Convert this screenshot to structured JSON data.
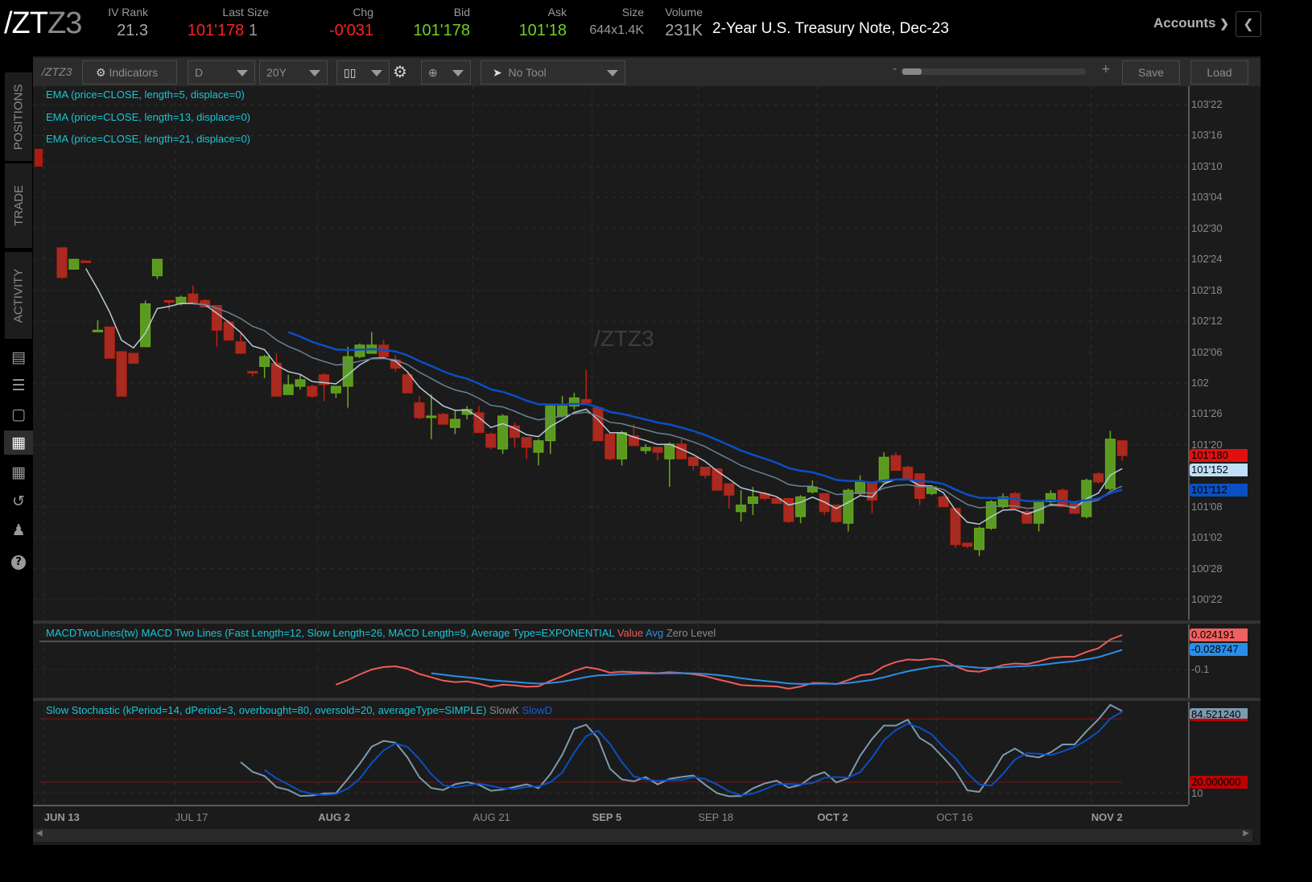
{
  "header": {
    "symbol_main": "/ZT",
    "symbol_suffix": "Z3",
    "description": "2-Year U.S. Treasury Note, Dec-23",
    "stats": {
      "iv_rank": {
        "label": "IV Rank",
        "value": "21.3"
      },
      "last_size": {
        "label": "Last Size",
        "value": "101'178",
        "size": "1"
      },
      "chg": {
        "label": "Chg",
        "value": "-0'031"
      },
      "bid": {
        "label": "Bid",
        "value": "101'178"
      },
      "ask": {
        "label": "Ask",
        "value": "101'18"
      },
      "size": {
        "label": "Size",
        "value": "644x1.4K"
      },
      "volume": {
        "label": "Volume",
        "value": "231K"
      }
    },
    "accounts_label": "Accounts",
    "colors": {
      "down": "#ff2020",
      "up": "#6fd21a"
    }
  },
  "sidebar": {
    "tabs": [
      "POSITIONS",
      "TRADE",
      "ACTIVITY"
    ],
    "icons": [
      "news-icon",
      "watchlist-icon",
      "tv-icon",
      "chart-icon",
      "grid-icon",
      "history-icon",
      "community-icon",
      "help-icon"
    ],
    "active_icon": "chart-icon"
  },
  "toolbar": {
    "symbol": "/ZTZ3",
    "indicators_label": "Indicators",
    "aggregation": "D",
    "timeframe": "20Y",
    "drawing_tool": "No Tool",
    "zoom_minus": "-",
    "zoom_plus": "+",
    "save_label": "Save",
    "load_label": "Load"
  },
  "chart_data": [
    {
      "type": "candlestick",
      "watermark": "/ZTZ3",
      "studies": [
        "EMA (price=CLOSE, length=5, displace=0)",
        "EMA (price=CLOSE, length=13, displace=0)",
        "EMA (price=CLOSE, length=21, displace=0)"
      ],
      "ema_lengths": [
        5,
        13,
        21
      ],
      "ema_colors": [
        "#b8cad8",
        "#6a8292",
        "#0a4fc4"
      ],
      "up_color": "#5a9a20",
      "down_color": "#a82a20",
      "ylim": [
        100.55,
        103.8
      ],
      "price_ticks": [
        {
          "label": "103'22",
          "value": 103.6875
        },
        {
          "label": "103'16",
          "value": 103.5
        },
        {
          "label": "103'10",
          "value": 103.3125
        },
        {
          "label": "103'04",
          "value": 103.125
        },
        {
          "label": "102'30",
          "value": 102.9375
        },
        {
          "label": "102'24",
          "value": 102.75
        },
        {
          "label": "102'18",
          "value": 102.5625
        },
        {
          "label": "102'12",
          "value": 102.375
        },
        {
          "label": "102'06",
          "value": 102.1875
        },
        {
          "label": "102",
          "value": 102.0
        },
        {
          "label": "101'26",
          "value": 101.8125
        },
        {
          "label": "101'20",
          "value": 101.625
        },
        {
          "label": "101'08",
          "value": 101.25
        },
        {
          "label": "101'02",
          "value": 101.0625
        },
        {
          "label": "100'28",
          "value": 100.875
        },
        {
          "label": "100'22",
          "value": 100.6875
        }
      ],
      "price_tags": [
        {
          "label": "101'180",
          "value": 101.5625,
          "color": "#e01010"
        },
        {
          "label": "101'152",
          "value": 101.475,
          "color": "#bfe0f8"
        },
        {
          "label": "101'112",
          "value": 101.35,
          "color": "#0a4fc4"
        }
      ],
      "x_ticks": [
        {
          "label": "JUN 13",
          "bold": true
        },
        {
          "label": "JUL 17",
          "bold": false
        },
        {
          "label": "AUG 2",
          "bold": true
        },
        {
          "label": "AUG 21",
          "bold": false
        },
        {
          "label": "SEP 5",
          "bold": true
        },
        {
          "label": "SEP 18",
          "bold": false
        },
        {
          "label": "OCT 2",
          "bold": true
        },
        {
          "label": "OCT 16",
          "bold": false
        },
        {
          "label": "NOV 2",
          "bold": true
        }
      ],
      "ohlc": [
        [
          102.82,
          102.82,
          102.63,
          102.64
        ],
        [
          102.69,
          102.75,
          102.69,
          102.75
        ],
        [
          102.74,
          102.74,
          102.73,
          102.73
        ],
        [
          102.32,
          102.38,
          102.32,
          102.32
        ],
        [
          102.34,
          102.34,
          102.15,
          102.15
        ],
        [
          102.19,
          102.19,
          101.92,
          101.92
        ],
        [
          102.18,
          102.18,
          102.12,
          102.12
        ],
        [
          102.22,
          102.5,
          102.22,
          102.48
        ],
        [
          102.65,
          102.75,
          102.63,
          102.75
        ],
        [
          102.5,
          102.5,
          102.44,
          102.49
        ],
        [
          102.48,
          102.53,
          102.47,
          102.52
        ],
        [
          102.54,
          102.59,
          102.48,
          102.48
        ],
        [
          102.5,
          102.51,
          102.46,
          102.46
        ],
        [
          102.47,
          102.47,
          102.22,
          102.32
        ],
        [
          102.37,
          102.38,
          102.26,
          102.26
        ],
        [
          102.25,
          102.3,
          102.18,
          102.18
        ],
        [
          102.07,
          102.07,
          102.04,
          102.06
        ],
        [
          102.1,
          102.17,
          102.03,
          102.16
        ],
        [
          102.12,
          102.18,
          101.92,
          101.92
        ],
        [
          101.93,
          102.05,
          101.93,
          101.99
        ],
        [
          101.98,
          102.05,
          101.96,
          102.02
        ],
        [
          101.98,
          101.99,
          101.91,
          101.92
        ],
        [
          102.05,
          102.06,
          101.89,
          101.99
        ],
        [
          101.94,
          101.98,
          101.91,
          101.98
        ],
        [
          101.98,
          102.22,
          101.85,
          102.16
        ],
        [
          102.16,
          102.24,
          102.15,
          102.23
        ],
        [
          102.18,
          102.31,
          102.18,
          102.23
        ],
        [
          102.23,
          102.26,
          102.15,
          102.16
        ],
        [
          102.14,
          102.17,
          102.07,
          102.09
        ],
        [
          102.05,
          102.06,
          101.94,
          101.94
        ],
        [
          101.88,
          101.92,
          101.78,
          101.79
        ],
        [
          101.79,
          101.93,
          101.66,
          101.8
        ],
        [
          101.81,
          101.82,
          101.75,
          101.75
        ],
        [
          101.73,
          101.84,
          101.69,
          101.78
        ],
        [
          101.81,
          101.86,
          101.78,
          101.84
        ],
        [
          101.82,
          101.86,
          101.7,
          101.7
        ],
        [
          101.69,
          101.7,
          101.6,
          101.61
        ],
        [
          101.6,
          101.81,
          101.57,
          101.8
        ],
        [
          101.74,
          101.76,
          101.61,
          101.67
        ],
        [
          101.67,
          101.67,
          101.54,
          101.61
        ],
        [
          101.58,
          101.66,
          101.5,
          101.65
        ],
        [
          101.65,
          101.87,
          101.57,
          101.86
        ],
        [
          101.8,
          101.92,
          101.79,
          101.86
        ],
        [
          101.86,
          101.94,
          101.84,
          101.91
        ],
        [
          101.9,
          102.08,
          101.88,
          101.88
        ],
        [
          101.85,
          101.86,
          101.65,
          101.65
        ],
        [
          101.69,
          101.69,
          101.53,
          101.54
        ],
        [
          101.54,
          101.71,
          101.5,
          101.7
        ],
        [
          101.68,
          101.75,
          101.62,
          101.62
        ],
        [
          101.59,
          101.63,
          101.57,
          101.61
        ],
        [
          101.61,
          101.61,
          101.53,
          101.58
        ],
        [
          101.54,
          101.64,
          101.37,
          101.63
        ],
        [
          101.63,
          101.66,
          101.54,
          101.54
        ],
        [
          101.55,
          101.55,
          101.47,
          101.5
        ],
        [
          101.49,
          101.49,
          101.42,
          101.44
        ],
        [
          101.48,
          101.48,
          101.35,
          101.35
        ],
        [
          101.39,
          101.39,
          101.24,
          101.32
        ],
        [
          101.22,
          101.35,
          101.16,
          101.26
        ],
        [
          101.27,
          101.37,
          101.2,
          101.31
        ],
        [
          101.33,
          101.34,
          101.29,
          101.3
        ],
        [
          101.3,
          101.31,
          101.27,
          101.27
        ],
        [
          101.3,
          101.3,
          101.15,
          101.16
        ],
        [
          101.19,
          101.32,
          101.15,
          101.31
        ],
        [
          101.34,
          101.41,
          101.33,
          101.37
        ],
        [
          101.33,
          101.33,
          101.2,
          101.22
        ],
        [
          101.26,
          101.26,
          101.15,
          101.16
        ],
        [
          101.15,
          101.36,
          101.1,
          101.35
        ],
        [
          101.33,
          101.44,
          101.32,
          101.4
        ],
        [
          101.4,
          101.4,
          101.21,
          101.29
        ],
        [
          101.4,
          101.58,
          101.4,
          101.55
        ],
        [
          101.56,
          101.58,
          101.47,
          101.47
        ],
        [
          101.49,
          101.5,
          101.42,
          101.42
        ],
        [
          101.45,
          101.45,
          101.26,
          101.3
        ],
        [
          101.33,
          101.38,
          101.32,
          101.37
        ],
        [
          101.31,
          101.32,
          101.25,
          101.25
        ],
        [
          101.24,
          101.24,
          101.0,
          101.02
        ],
        [
          101.03,
          101.03,
          101.0,
          101.01
        ],
        [
          100.99,
          101.13,
          100.95,
          101.12
        ],
        [
          101.12,
          101.29,
          101.11,
          101.28
        ],
        [
          101.25,
          101.33,
          101.24,
          101.31
        ],
        [
          101.33,
          101.34,
          101.24,
          101.24
        ],
        [
          101.22,
          101.23,
          101.15,
          101.15
        ],
        [
          101.15,
          101.29,
          101.1,
          101.28
        ],
        [
          101.28,
          101.35,
          101.27,
          101.33
        ],
        [
          101.35,
          101.36,
          101.25,
          101.25
        ],
        [
          101.27,
          101.28,
          101.21,
          101.21
        ],
        [
          101.19,
          101.42,
          101.18,
          101.41
        ],
        [
          101.45,
          101.46,
          101.39,
          101.4
        ],
        [
          101.36,
          101.71,
          101.35,
          101.66
        ],
        [
          101.65,
          101.65,
          101.53,
          101.56
        ]
      ]
    },
    {
      "type": "line",
      "title": "MACDTwoLines(tw) MACD Two Lines (Fast Length=12, Slow Length=26, MACD Length=9, Average Type=EXPONENTIAL",
      "series": [
        {
          "name": "Value",
          "color": "#f05a5a"
        },
        {
          "name": "Avg",
          "color": "#2a8ee8"
        },
        {
          "name": "Zero Level",
          "color": "#8a8a8a"
        }
      ],
      "params": {
        "fast": 12,
        "slow": 26,
        "signal": 9
      },
      "y_ticks": [
        {
          "label": "-0.1",
          "value": -0.1
        }
      ],
      "value_tags": [
        {
          "label": "0.024191",
          "color": "#f06060"
        },
        {
          "label": "-0.028747",
          "color": "#2a8ee8"
        }
      ]
    },
    {
      "type": "line",
      "title": "Slow Stochastic (kPeriod=14, dPeriod=3, overbought=80, oversold=20, averageType=SIMPLE)",
      "series": [
        {
          "name": "SlowK",
          "color": "#7b9aae"
        },
        {
          "name": "SlowD",
          "color": "#0a4fc4"
        }
      ],
      "params": {
        "k": 14,
        "d": 3,
        "overbought": 80,
        "oversold": 20
      },
      "ylim": [
        0,
        100
      ],
      "y_ticks": [
        {
          "label": "10",
          "value": 10
        }
      ],
      "value_tags": [
        {
          "label": "84.521240",
          "color": "#7b9aae"
        },
        {
          "label": "20.000000",
          "color": "#c00000"
        }
      ]
    }
  ]
}
